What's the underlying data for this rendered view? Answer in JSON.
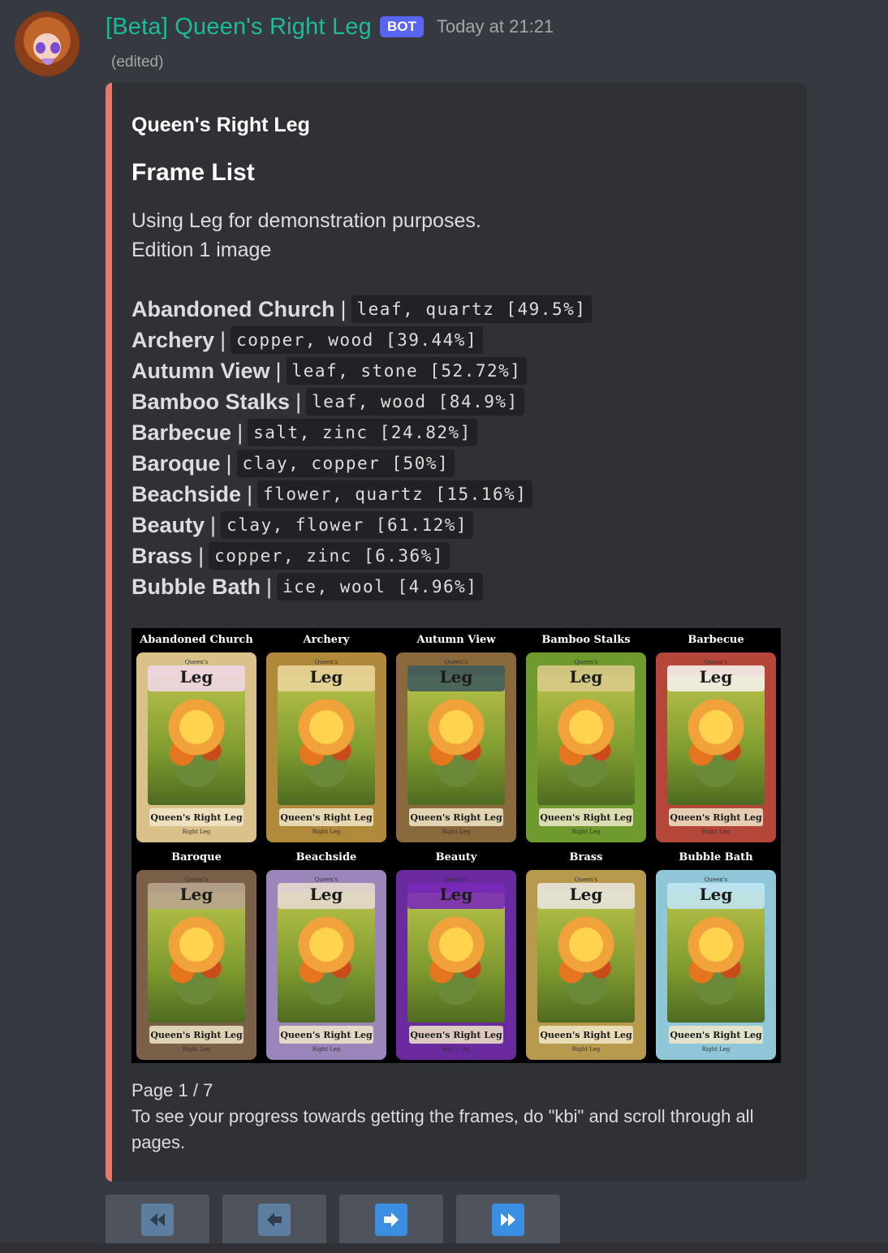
{
  "message": {
    "username": "[Beta] Queen's Right Leg",
    "bot_tag": "BOT",
    "timestamp": "Today at 21:21",
    "edited": "(edited)"
  },
  "embed": {
    "accent_color": "#e9776a",
    "author": "Queen's Right Leg",
    "title": "Frame List",
    "description_line1": "Using Leg for demonstration purposes.",
    "description_line2": "Edition 1 image",
    "frames": [
      {
        "name": "Abandoned Church",
        "materials": "leaf, quartz [49.5%]"
      },
      {
        "name": "Archery",
        "materials": "copper, wood [39.44%]"
      },
      {
        "name": "Autumn View",
        "materials": "leaf, stone [52.72%]"
      },
      {
        "name": "Bamboo Stalks",
        "materials": "leaf, wood [84.9%]"
      },
      {
        "name": "Barbecue",
        "materials": "salt, zinc [24.82%]"
      },
      {
        "name": "Baroque",
        "materials": "clay, copper [50%]"
      },
      {
        "name": "Beachside",
        "materials": "flower, quartz [15.16%]"
      },
      {
        "name": "Beauty",
        "materials": "clay, flower [61.12%]"
      },
      {
        "name": "Brass",
        "materials": "copper, zinc [6.36%]"
      },
      {
        "name": "Bubble Bath",
        "materials": "ice, wool [4.96%]"
      }
    ],
    "separator": "|",
    "image": {
      "card_title": "Leg",
      "card_name": "Queen's Right Leg",
      "card_top_tag": "Queen's",
      "card_bottom_tag": "Right Leg",
      "cards": [
        {
          "label": "Abandoned Church",
          "frame_color": "#d9c18a",
          "title_bg": "#f0d6e6"
        },
        {
          "label": "Archery",
          "frame_color": "#b08a3a",
          "title_bg": "#e8d39a"
        },
        {
          "label": "Autumn View",
          "frame_color": "#8a6a3c",
          "title_bg": "#3f5c5a"
        },
        {
          "label": "Bamboo Stalks",
          "frame_color": "#6e9a2e",
          "title_bg": "#d8c98a"
        },
        {
          "label": "Barbecue",
          "frame_color": "#b5473a",
          "title_bg": "#f4f0ea"
        },
        {
          "label": "Baroque",
          "frame_color": "#7a6048",
          "title_bg": "#b8a48e"
        },
        {
          "label": "Beachside",
          "frame_color": "#9a86b8",
          "title_bg": "#e6d8cc"
        },
        {
          "label": "Beauty",
          "frame_color": "#6a2aa0",
          "title_bg": "#7a2ab8"
        },
        {
          "label": "Brass",
          "frame_color": "#b89a4e",
          "title_bg": "#e8e4dc"
        },
        {
          "label": "Bubble Bath",
          "frame_color": "#8fc7d8",
          "title_bg": "#bfe6f2"
        }
      ]
    },
    "footer_page": "Page 1 / 7",
    "footer_text": "To see your progress towards getting the frames, do \"kbi\" and scroll through all pages."
  },
  "buttons": [
    {
      "icon": "rewind-icon",
      "state": "disabled"
    },
    {
      "icon": "left-arrow-icon",
      "state": "disabled"
    },
    {
      "icon": "right-arrow-icon",
      "state": "enabled"
    },
    {
      "icon": "fast-forward-icon",
      "state": "enabled"
    }
  ]
}
